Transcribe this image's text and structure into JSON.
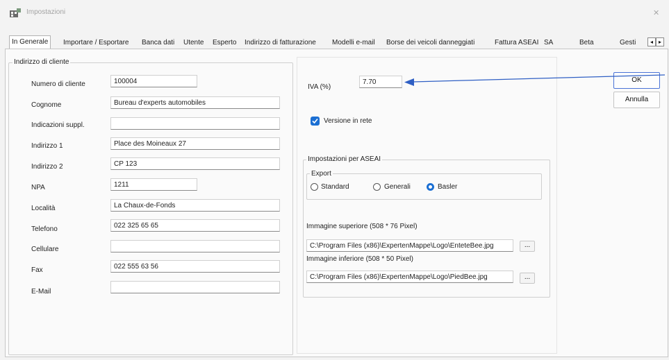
{
  "window": {
    "title": "Impostazioni",
    "close": "✕"
  },
  "tabs": [
    "In Generale",
    "Importare / Esportare",
    "Banca dati",
    "Utente",
    "Esperto",
    "Indirizzo di fatturazione",
    "Modelli e-mail",
    "Borse dei veicoli danneggiati",
    "Fattura ASEAI",
    "SA",
    "Beta",
    "Gesti"
  ],
  "tab_scroll": {
    "left": "◂",
    "right": "▸"
  },
  "client_address": {
    "group_label": "Indirizzo di cliente",
    "fields": [
      {
        "label": "Numero di cliente",
        "value": "100004"
      },
      {
        "label": "Cognome",
        "value": "Bureau d'experts automobiles"
      },
      {
        "label": "Indicazioni suppl.",
        "value": ""
      },
      {
        "label": "Indirizzo 1",
        "value": "Place des Moineaux 27"
      },
      {
        "label": "Indirizzo 2",
        "value": "CP 123"
      },
      {
        "label": "NPA",
        "value": "1211"
      },
      {
        "label": "Località",
        "value": "La Chaux-de-Fonds"
      },
      {
        "label": "Telefono",
        "value": "022 325 65 65"
      },
      {
        "label": "Cellulare",
        "value": ""
      },
      {
        "label": "Fax",
        "value": "022 555 63 56"
      },
      {
        "label": "E-Mail",
        "value": ""
      }
    ]
  },
  "vat": {
    "label": "IVA (%)",
    "value": "7.70"
  },
  "network_version": {
    "label": "Versione in rete",
    "checked": true
  },
  "aseai": {
    "group_label": "Impostazioni per ASEAI",
    "export": {
      "label": "Export",
      "options": [
        "Standard",
        "Generali",
        "Basler"
      ],
      "selected": "Basler"
    },
    "top_image": {
      "label": "Immagine superiore (508 * 76 Pixel)",
      "path": "C:\\Program Files (x86)\\ExpertenMappe\\Logo\\EnteteBee.jpg"
    },
    "bottom_image": {
      "label": "Immagine inferiore (508 * 50 Pixel)",
      "path": "C:\\Program Files (x86)\\ExpertenMappe\\Logo\\PiedBee.jpg"
    },
    "browse_label": "..."
  },
  "buttons": {
    "ok": "OK",
    "cancel": "Annulla"
  },
  "colors": {
    "accent": "#1b6fd3",
    "arrow": "#2f5fc4",
    "primary_button_border": "#4a73d6"
  }
}
